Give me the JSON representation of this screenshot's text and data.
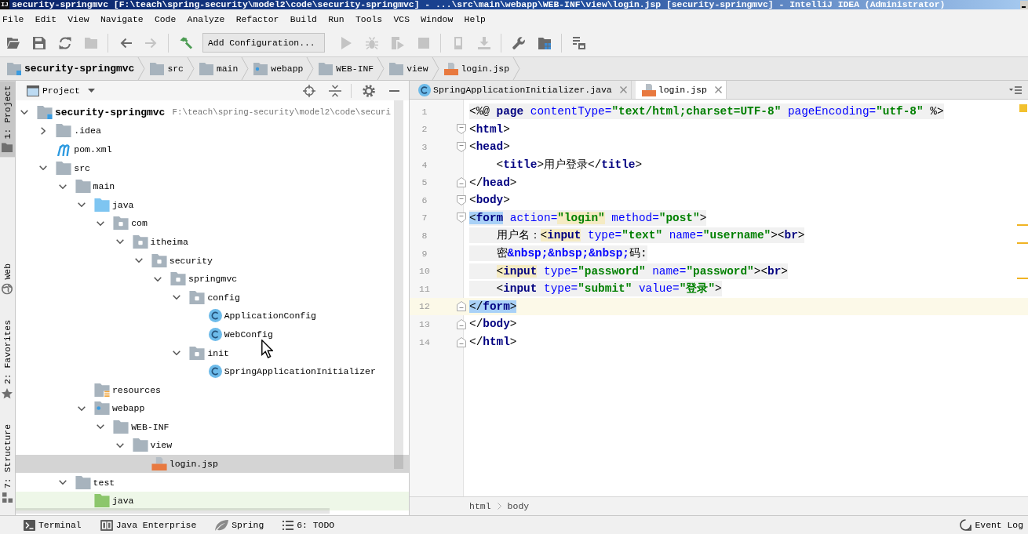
{
  "window": {
    "icon_label": "IJ",
    "title": "security-springmvc [F:\\teach\\spring-security\\model2\\code\\security-springmvc] - ...\\src\\main\\webapp\\WEB-INF\\view\\login.jsp [security-springmvc] - IntelliJ IDEA (Administrator)"
  },
  "menu": [
    "File",
    "Edit",
    "View",
    "Navigate",
    "Code",
    "Analyze",
    "Refactor",
    "Build",
    "Run",
    "Tools",
    "VCS",
    "Window",
    "Help"
  ],
  "toolbar": {
    "groups": [
      {
        "buttons": [
          {
            "kind": "open",
            "disabled": false
          },
          {
            "kind": "save",
            "disabled": false
          },
          {
            "kind": "sync",
            "disabled": false
          },
          {
            "kind": "folder",
            "disabled": true
          }
        ]
      },
      {
        "buttons": [
          {
            "kind": "back",
            "disabled": false
          },
          {
            "kind": "forward",
            "disabled": true
          }
        ]
      },
      {
        "buttons": [
          {
            "kind": "build",
            "disabled": false
          },
          {
            "kind": "run-config",
            "label": "Add Configuration...",
            "disabled": false
          },
          {
            "kind": "run",
            "disabled": true
          },
          {
            "kind": "debug",
            "disabled": true
          },
          {
            "kind": "coverage",
            "disabled": true
          },
          {
            "kind": "stop",
            "disabled": true
          }
        ]
      },
      {
        "buttons": [
          {
            "kind": "device",
            "disabled": true
          },
          {
            "kind": "download",
            "disabled": true
          }
        ]
      },
      {
        "buttons": [
          {
            "kind": "settings",
            "disabled": false
          },
          {
            "kind": "structure",
            "disabled": false
          }
        ]
      },
      {
        "buttons": [
          {
            "kind": "sdk",
            "disabled": false
          }
        ]
      }
    ]
  },
  "navigation_bar": [
    {
      "kind": "module",
      "label": "security-springmvc"
    },
    {
      "kind": "folder",
      "label": "src"
    },
    {
      "kind": "folder",
      "label": "main"
    },
    {
      "kind": "web",
      "label": "webapp"
    },
    {
      "kind": "folder",
      "label": "WEB-INF"
    },
    {
      "kind": "folder",
      "label": "view"
    },
    {
      "kind": "jsp",
      "label": "login.jsp"
    }
  ],
  "tool_windows": {
    "top": [
      {
        "kind": "project",
        "label": "1: Project",
        "selected": true
      }
    ],
    "bottom": [
      {
        "kind": "web",
        "label": "Web",
        "selected": false
      },
      {
        "kind": "favorites",
        "label": "2: Favorites",
        "selected": false
      },
      {
        "kind": "structure",
        "label": "7: Structure",
        "selected": false
      }
    ]
  },
  "project_panel": {
    "title": "Project",
    "tree": [
      {
        "kind": "module",
        "label": "security-springmvc",
        "path": "F:\\teach\\spring-security\\model2\\code\\securi",
        "expanded": true,
        "selected": false,
        "children": [
          {
            "kind": "folder",
            "label": ".idea",
            "expanded": false,
            "selected": false
          },
          {
            "kind": "maven",
            "label": "pom.xml",
            "selected": false
          },
          {
            "kind": "folder",
            "label": "src",
            "expanded": true,
            "selected": false,
            "children": [
              {
                "kind": "folder",
                "label": "main",
                "expanded": true,
                "selected": false,
                "children": [
                  {
                    "kind": "source-root",
                    "label": "java",
                    "expanded": true,
                    "selected": false,
                    "children": [
                      {
                        "kind": "package",
                        "label": "com",
                        "expanded": true,
                        "selected": false,
                        "children": [
                          {
                            "kind": "package",
                            "label": "itheima",
                            "expanded": true,
                            "selected": false,
                            "children": [
                              {
                                "kind": "package",
                                "label": "security",
                                "expanded": true,
                                "selected": false,
                                "children": [
                                  {
                                    "kind": "package",
                                    "label": "springmvc",
                                    "expanded": true,
                                    "selected": false,
                                    "children": [
                                      {
                                        "kind": "package",
                                        "label": "config",
                                        "expanded": true,
                                        "selected": false,
                                        "children": [
                                          {
                                            "kind": "class",
                                            "label": "ApplicationConfig",
                                            "selected": false
                                          },
                                          {
                                            "kind": "class",
                                            "label": "WebConfig",
                                            "selected": false
                                          }
                                        ]
                                      },
                                      {
                                        "kind": "package",
                                        "label": "init",
                                        "expanded": true,
                                        "selected": false,
                                        "children": [
                                          {
                                            "kind": "class",
                                            "label": "SpringApplicationInitializer",
                                            "selected": false
                                          }
                                        ]
                                      }
                                    ]
                                  }
                                ]
                              }
                            ]
                          }
                        ]
                      }
                    ]
                  },
                  {
                    "kind": "resources-root",
                    "label": "resources",
                    "selected": false
                  },
                  {
                    "kind": "web",
                    "label": "webapp",
                    "expanded": true,
                    "selected": false,
                    "children": [
                      {
                        "kind": "folder",
                        "label": "WEB-INF",
                        "expanded": true,
                        "selected": false,
                        "children": [
                          {
                            "kind": "folder",
                            "label": "view",
                            "expanded": true,
                            "selected": false,
                            "children": [
                              {
                                "kind": "jsp",
                                "label": "login.jsp",
                                "selected": true
                              }
                            ]
                          }
                        ]
                      }
                    ]
                  }
                ]
              },
              {
                "kind": "folder",
                "label": "test",
                "expanded": true,
                "selected": false,
                "children": [
                  {
                    "kind": "test-root",
                    "label": "java",
                    "selected": false
                  }
                ]
              }
            ]
          }
        ]
      }
    ]
  },
  "editor": {
    "tabs": [
      {
        "kind": "class",
        "label": "SpringApplicationInitializer.java",
        "selected": false
      },
      {
        "kind": "jsp",
        "label": "login.jsp",
        "selected": true
      }
    ],
    "lines": [
      {
        "number": "1",
        "current": false,
        "shaded": true,
        "fold_start": false,
        "fold_end": false,
        "tokens": [
          {
            "kind": "bracket",
            "text": "<%@"
          },
          {
            "kind": "tag",
            "text": " page"
          },
          {
            "kind": "attr",
            "text": " contentType="
          },
          {
            "kind": "value",
            "text": "\"text/html;charset=UTF-8\""
          },
          {
            "kind": "attr",
            "text": " pageEncoding="
          },
          {
            "kind": "value",
            "text": "\"utf-8\""
          },
          {
            "kind": "bracket",
            "text": " %>"
          }
        ]
      },
      {
        "number": "2",
        "current": false,
        "shaded": false,
        "fold_start": true,
        "fold_end": false,
        "tokens": [
          {
            "kind": "bracket",
            "text": "<"
          },
          {
            "kind": "tag",
            "text": "html"
          },
          {
            "kind": "bracket",
            "text": ">"
          }
        ]
      },
      {
        "number": "3",
        "current": false,
        "shaded": false,
        "fold_start": true,
        "fold_end": false,
        "tokens": [
          {
            "kind": "bracket",
            "text": "<"
          },
          {
            "kind": "tag",
            "text": "head"
          },
          {
            "kind": "bracket",
            "text": ">"
          }
        ]
      },
      {
        "number": "4",
        "current": false,
        "shaded": false,
        "fold_start": false,
        "fold_end": false,
        "tokens": [
          {
            "kind": "bracket",
            "text": "    <"
          },
          {
            "kind": "tag",
            "text": "title"
          },
          {
            "kind": "bracket",
            "text": ">"
          },
          {
            "kind": "text",
            "text": "用户登录"
          },
          {
            "kind": "bracket",
            "text": "</"
          },
          {
            "kind": "tag",
            "text": "title"
          },
          {
            "kind": "bracket",
            "text": ">"
          }
        ]
      },
      {
        "number": "5",
        "current": false,
        "shaded": false,
        "fold_start": false,
        "fold_end": true,
        "tokens": [
          {
            "kind": "bracket",
            "text": "</"
          },
          {
            "kind": "tag",
            "text": "head"
          },
          {
            "kind": "bracket",
            "text": ">"
          }
        ]
      },
      {
        "number": "6",
        "current": false,
        "shaded": false,
        "fold_start": true,
        "fold_end": false,
        "tokens": [
          {
            "kind": "bracket",
            "text": "<"
          },
          {
            "kind": "tag",
            "text": "body"
          },
          {
            "kind": "bracket",
            "text": ">"
          }
        ]
      },
      {
        "number": "7",
        "current": false,
        "shaded": true,
        "fold_start": true,
        "fold_end": false,
        "tokens": [
          {
            "kind": "match",
            "tokens": [
              {
                "kind": "bracket",
                "text": "<"
              },
              {
                "kind": "tag",
                "text": "form"
              }
            ]
          },
          {
            "kind": "attr",
            "text": " action="
          },
          {
            "kind": "warning",
            "tokens": [
              {
                "kind": "value",
                "text": "\"login\""
              }
            ]
          },
          {
            "kind": "attr",
            "text": " method="
          },
          {
            "kind": "value",
            "text": "\"post\""
          },
          {
            "kind": "bracket",
            "text": ">"
          }
        ]
      },
      {
        "number": "8",
        "current": false,
        "shaded": true,
        "fold_start": false,
        "fold_end": false,
        "tokens": [
          {
            "kind": "text",
            "text": "    用户名："
          },
          {
            "kind": "warning",
            "tokens": [
              {
                "kind": "bracket",
                "text": "<"
              },
              {
                "kind": "tag",
                "text": "input"
              }
            ]
          },
          {
            "kind": "attr",
            "text": " type="
          },
          {
            "kind": "value",
            "text": "\"text\""
          },
          {
            "kind": "attr",
            "text": " name="
          },
          {
            "kind": "value",
            "text": "\"username\""
          },
          {
            "kind": "bracket",
            "text": "><"
          },
          {
            "kind": "tag",
            "text": "br"
          },
          {
            "kind": "bracket",
            "text": ">"
          }
        ]
      },
      {
        "number": "9",
        "current": false,
        "shaded": true,
        "fold_start": false,
        "fold_end": false,
        "tokens": [
          {
            "kind": "text",
            "text": "    密"
          },
          {
            "kind": "entity",
            "text": "&nbsp;&nbsp;&nbsp;"
          },
          {
            "kind": "text",
            "text": "码:"
          }
        ]
      },
      {
        "number": "10",
        "current": false,
        "shaded": true,
        "fold_start": false,
        "fold_end": false,
        "tokens": [
          {
            "kind": "warning",
            "tokens": [
              {
                "kind": "bracket",
                "text": "    <"
              },
              {
                "kind": "tag",
                "text": "input"
              }
            ]
          },
          {
            "kind": "attr",
            "text": " type="
          },
          {
            "kind": "value",
            "text": "\"password\""
          },
          {
            "kind": "attr",
            "text": " name="
          },
          {
            "kind": "value",
            "text": "\"password\""
          },
          {
            "kind": "bracket",
            "text": "><"
          },
          {
            "kind": "tag",
            "text": "br"
          },
          {
            "kind": "bracket",
            "text": ">"
          }
        ]
      },
      {
        "number": "11",
        "current": false,
        "shaded": true,
        "fold_start": false,
        "fold_end": false,
        "tokens": [
          {
            "kind": "bracket",
            "text": "    <"
          },
          {
            "kind": "tag",
            "text": "input"
          },
          {
            "kind": "attr",
            "text": " type="
          },
          {
            "kind": "value",
            "text": "\"submit\""
          },
          {
            "kind": "attr",
            "text": " value="
          },
          {
            "kind": "value",
            "text": "\"登录\""
          },
          {
            "kind": "bracket",
            "text": ">"
          }
        ]
      },
      {
        "number": "12",
        "current": true,
        "shaded": false,
        "fold_start": false,
        "fold_end": true,
        "tokens": [
          {
            "kind": "match",
            "tokens": [
              {
                "kind": "bracket",
                "text": "</"
              },
              {
                "kind": "tag",
                "text": "form"
              },
              {
                "kind": "bracket",
                "text": ">"
              }
            ]
          }
        ]
      },
      {
        "number": "13",
        "current": false,
        "shaded": false,
        "fold_start": false,
        "fold_end": true,
        "tokens": [
          {
            "kind": "bracket",
            "text": "</"
          },
          {
            "kind": "tag",
            "text": "body"
          },
          {
            "kind": "bracket",
            "text": ">"
          }
        ]
      },
      {
        "number": "14",
        "current": false,
        "shaded": false,
        "fold_start": false,
        "fold_end": true,
        "tokens": [
          {
            "kind": "bracket",
            "text": "</"
          },
          {
            "kind": "tag",
            "text": "html"
          },
          {
            "kind": "bracket",
            "text": ">"
          }
        ]
      }
    ],
    "breadcrumb": [
      "html",
      "body"
    ]
  },
  "bottom_bar": {
    "left": [
      {
        "kind": "terminal",
        "label": "Terminal"
      },
      {
        "kind": "enterprise",
        "label": "Java Enterprise"
      },
      {
        "kind": "spring",
        "label": "Spring"
      },
      {
        "kind": "todo",
        "label": "6: TODO"
      }
    ],
    "right": [
      {
        "kind": "log",
        "label": "Event Log"
      }
    ]
  }
}
